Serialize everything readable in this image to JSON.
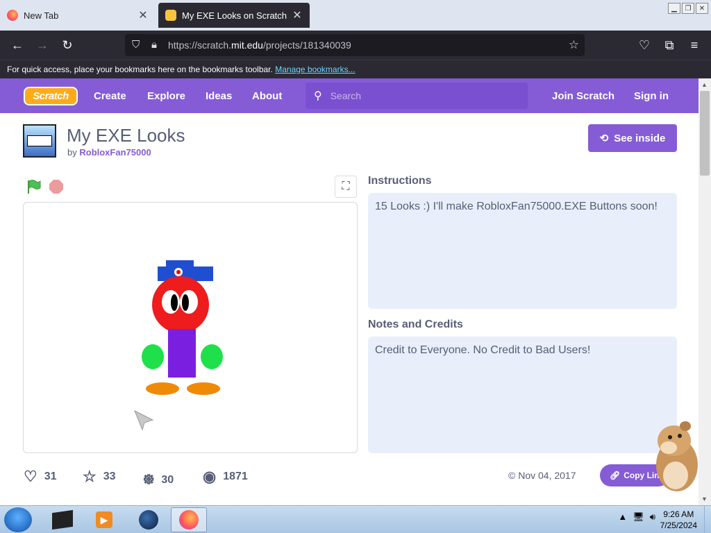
{
  "browser": {
    "tabs": [
      {
        "title": "New Tab",
        "active": false
      },
      {
        "title": "My EXE Looks on Scratch",
        "active": true
      }
    ],
    "url": {
      "prefix": "https://scratch.",
      "domain": "mit.edu",
      "path": "/projects/181340039"
    },
    "bookmarks_bar": {
      "text": "For quick access, place your bookmarks here on the bookmarks toolbar.",
      "link": "Manage bookmarks..."
    }
  },
  "scratch": {
    "logo_text": "Scratch",
    "nav": {
      "create": "Create",
      "explore": "Explore",
      "ideas": "Ideas",
      "about": "About",
      "join": "Join Scratch",
      "signin": "Sign in"
    },
    "search_placeholder": "Search",
    "project": {
      "title": "My EXE Looks",
      "by_label": "by",
      "author": "RobloxFan75000",
      "see_inside": "See inside",
      "instructions_heading": "Instructions",
      "instructions": "15 Looks :) I'll make RobloxFan75000.EXE Buttons soon!",
      "notes_heading": "Notes and Credits",
      "notes": "Credit to Everyone. No Credit to Bad Users!",
      "stats": {
        "loves": "31",
        "favorites": "33",
        "remixes": "30",
        "views": "1871"
      },
      "date": "Nov 04, 2017",
      "copy_link": "Copy Link"
    }
  },
  "taskbar": {
    "time": "9:26 AM",
    "date": "7/25/2024"
  },
  "colors": {
    "scratch_purple": "#855cd6",
    "browser_dark": "#2b2a33",
    "info_bg": "#e9eefb",
    "text": "#575e75"
  }
}
